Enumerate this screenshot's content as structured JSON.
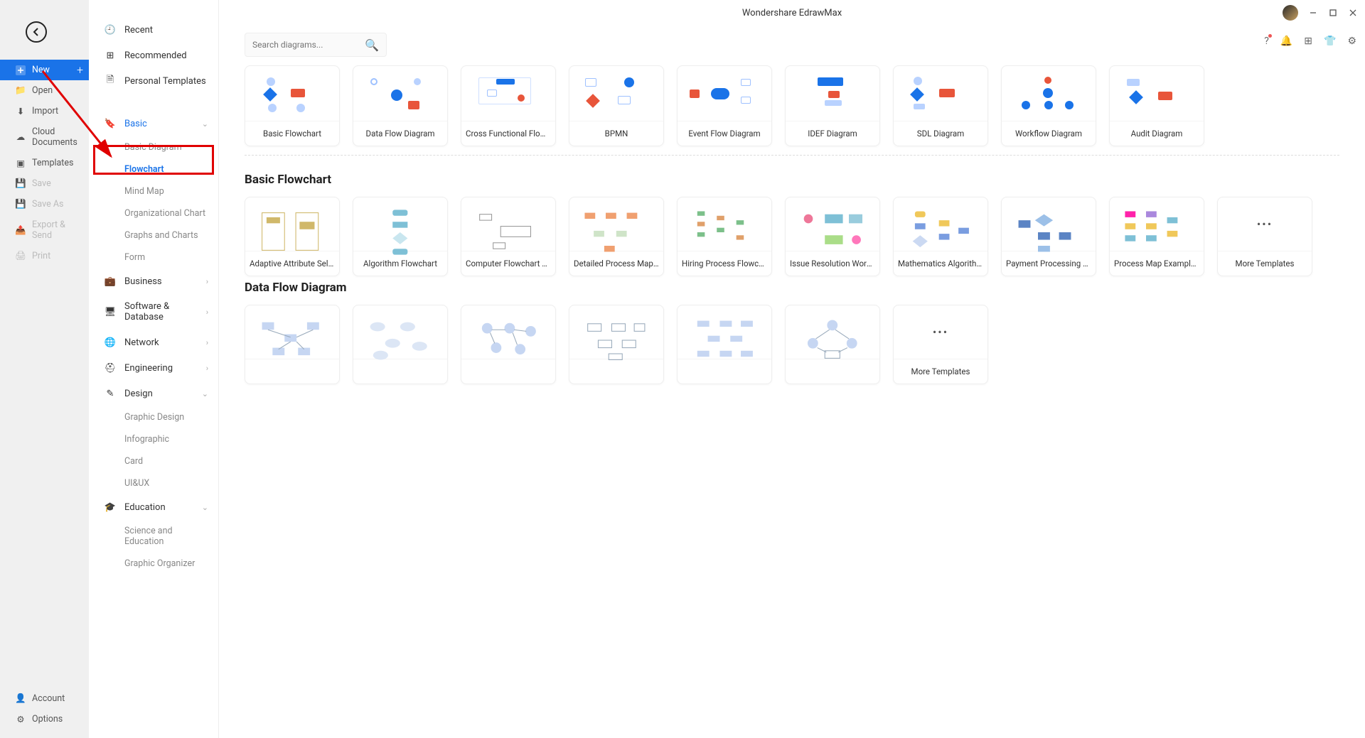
{
  "app_title": "Wondershare EdrawMax",
  "search": {
    "placeholder": "Search diagrams..."
  },
  "left_nav": {
    "new": "New",
    "open": "Open",
    "import": "Import",
    "cloud": "Cloud Documents",
    "templates": "Templates",
    "save": "Save",
    "save_as": "Save As",
    "export": "Export & Send",
    "print": "Print",
    "account": "Account",
    "options": "Options"
  },
  "cat_nav": {
    "recent": "Recent",
    "recommended": "Recommended",
    "personal": "Personal Templates",
    "basic": "Basic",
    "basic_items": [
      "Basic Diagram",
      "Flowchart",
      "Mind Map",
      "Organizational Chart",
      "Graphs and Charts",
      "Form"
    ],
    "business": "Business",
    "software": "Software & Database",
    "network": "Network",
    "engineering": "Engineering",
    "design": "Design",
    "design_items": [
      "Graphic Design",
      "Infographic",
      "Card",
      "UI&UX"
    ],
    "education": "Education",
    "education_items": [
      "Science and Education",
      "Graphic Organizer"
    ]
  },
  "top_templates": [
    "Basic Flowchart",
    "Data Flow Diagram",
    "Cross Functional Flow...",
    "BPMN",
    "Event Flow Diagram",
    "IDEF Diagram",
    "SDL Diagram",
    "Workflow Diagram",
    "Audit Diagram"
  ],
  "sections": [
    {
      "title": "Basic Flowchart",
      "cards": [
        "Adaptive Attribute Selectio...",
        "Algorithm Flowchart",
        "Computer Flowchart Temp...",
        "Detailed Process Map Tem...",
        "Hiring Process Flowchart",
        "Issue Resolution Workflow ...",
        "Mathematics Algorithm Fl...",
        "Payment Processing Workf...",
        "Process Map Examples Te..."
      ],
      "more": "More Templates"
    },
    {
      "title": "Data Flow Diagram",
      "cards": [
        "",
        "",
        "",
        "",
        "",
        ""
      ],
      "more": "More Templates"
    }
  ]
}
